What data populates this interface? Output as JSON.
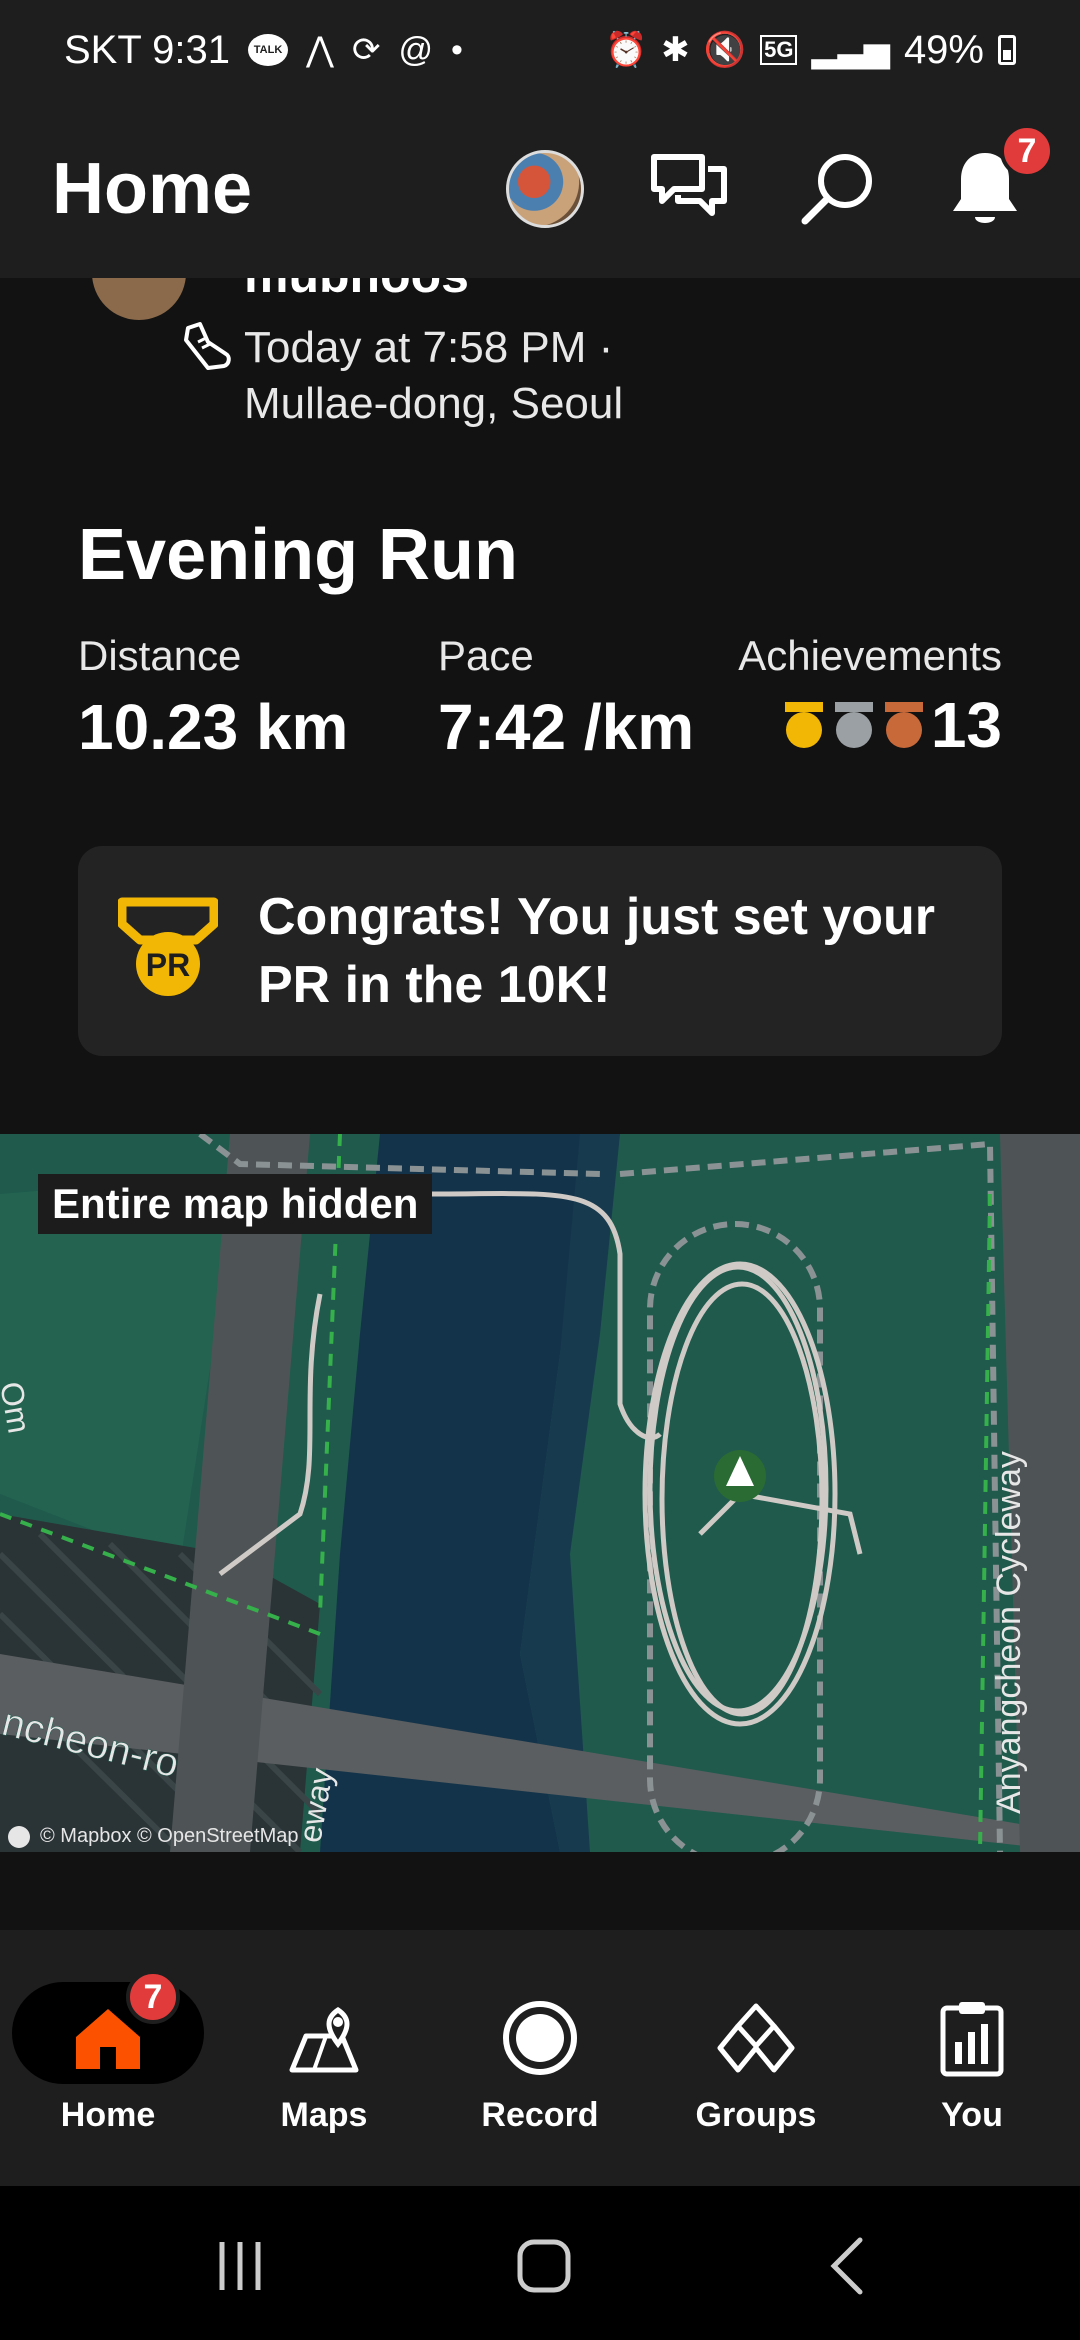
{
  "status_bar": {
    "carrier_time": "SKT 9:31",
    "talk_label": "TALK",
    "network": "5G",
    "battery": "49%"
  },
  "header": {
    "title": "Home",
    "notification_count": "7"
  },
  "activity": {
    "athlete_name": "mubnoos",
    "time_line": "Today at 7:58 PM ·",
    "location": "Mullae-dong, Seoul",
    "title": "Evening Run",
    "stats": {
      "distance_label": "Distance",
      "distance_value": "10.23 km",
      "pace_label": "Pace",
      "pace_value": "7:42 /km",
      "achievements_label": "Achievements",
      "achievements_value": "13"
    },
    "pr_badge_text": "PR",
    "pr_message": "Congrats! You just set your PR in the 10K!",
    "map": {
      "hidden_label": "Entire map hidden",
      "attribution": "© Mapbox © OpenStreetMap",
      "road_label_1": "Anyangcheon Cycleway",
      "road_label_2": "ncheon-ro",
      "road_label_3": "eway",
      "road_label_4": "Om"
    }
  },
  "bottom_nav": {
    "items": [
      {
        "label": "Home",
        "icon": "home-icon",
        "badge": "7"
      },
      {
        "label": "Maps",
        "icon": "maps-icon"
      },
      {
        "label": "Record",
        "icon": "record-icon"
      },
      {
        "label": "Groups",
        "icon": "groups-icon"
      },
      {
        "label": "You",
        "icon": "you-icon"
      }
    ],
    "active_color": "#fc5200"
  },
  "colors": {
    "gold": "#f2b705",
    "silver": "#9aa0a3",
    "bronze": "#c8693a",
    "badge_red": "#e23b3b"
  }
}
